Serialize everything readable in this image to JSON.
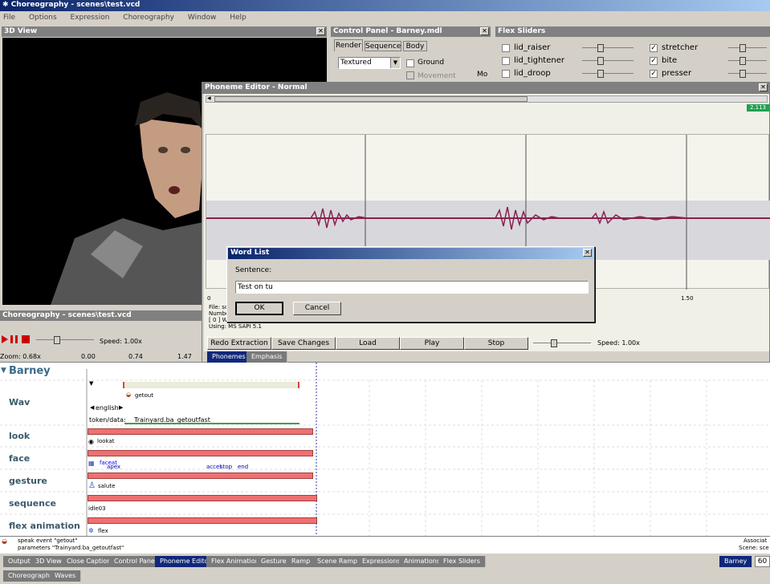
{
  "app": {
    "title": "Choreography - scenes\\test.vcd"
  },
  "menu": [
    "File",
    "Options",
    "Expression",
    "Choreography",
    "Window",
    "Help"
  ],
  "view3d": {
    "title": "3D View"
  },
  "control_panel": {
    "title": "Control Panel - Barney.mdl",
    "tabs": [
      "Render",
      "Sequence",
      "Body"
    ],
    "render_mode": "Textured",
    "ground": "Ground",
    "movement": "Movement",
    "more": "Mo"
  },
  "flex_sliders": {
    "title": "Flex Sliders",
    "left": [
      "lid_raiser",
      "lid_tightener",
      "lid_droop"
    ],
    "right": [
      "stretcher",
      "bite",
      "presser"
    ]
  },
  "phoneme_editor": {
    "title": "Phoneme Editor - Normal",
    "time_badge": "2.113",
    "tick_start": "0",
    "tick_mid": "1.50",
    "info": [
      "File: sc",
      "Numbe",
      "[ 0 ] W",
      "Using: MS SAPI 5.1"
    ],
    "buttons": [
      "Redo Extraction",
      "Save Changes",
      "Load",
      "Play",
      "Stop"
    ],
    "speed": "Speed: 1.00x",
    "tabs": [
      "Phonemes",
      "Emphasis"
    ]
  },
  "word_list": {
    "title": "Word List",
    "label": "Sentence:",
    "value": "Test on tu",
    "ok": "OK",
    "cancel": "Cancel"
  },
  "choreo": {
    "title": "Choreography - scenes\\test.vcd",
    "speed": "Speed: 1.00x",
    "zoom": "Zoom: 0.68x",
    "t0": "0.00",
    "t1": "0.74",
    "t2": "1.47",
    "actor": "Barney",
    "rows": [
      "Wav",
      "look",
      "face",
      "gesture",
      "sequence",
      "flex animation"
    ],
    "events": {
      "getout": "getout",
      "english": "english",
      "token": "token/data:",
      "trainyard": "Trainyard.ba_getoutfast",
      "lookat": "lookat",
      "faceat": "faceat",
      "apex": "apex",
      "accel": "accel",
      "stop": "stop",
      "end": "end",
      "salute": "salute",
      "idle": "idle03",
      "flex": "flex"
    }
  },
  "status": {
    "line1": "speak event \"getout\"",
    "line2": "parameters \"Trainyard.ba_getoutfast\"",
    "assoc": "Associat",
    "scene": "Scene: sce"
  },
  "bottom_tabs": [
    "Output",
    "3D View",
    "Close Caption",
    "Control Panel",
    "Phoneme Editor",
    "Flex Animation",
    "Gesture",
    "Ramp",
    "Scene Ramp",
    "Expressions",
    "Animations",
    "Flex Sliders"
  ],
  "bottom_tabs2": [
    "Choreography",
    "Waves"
  ],
  "actor_tab": "Barney",
  "corner_num": "60"
}
